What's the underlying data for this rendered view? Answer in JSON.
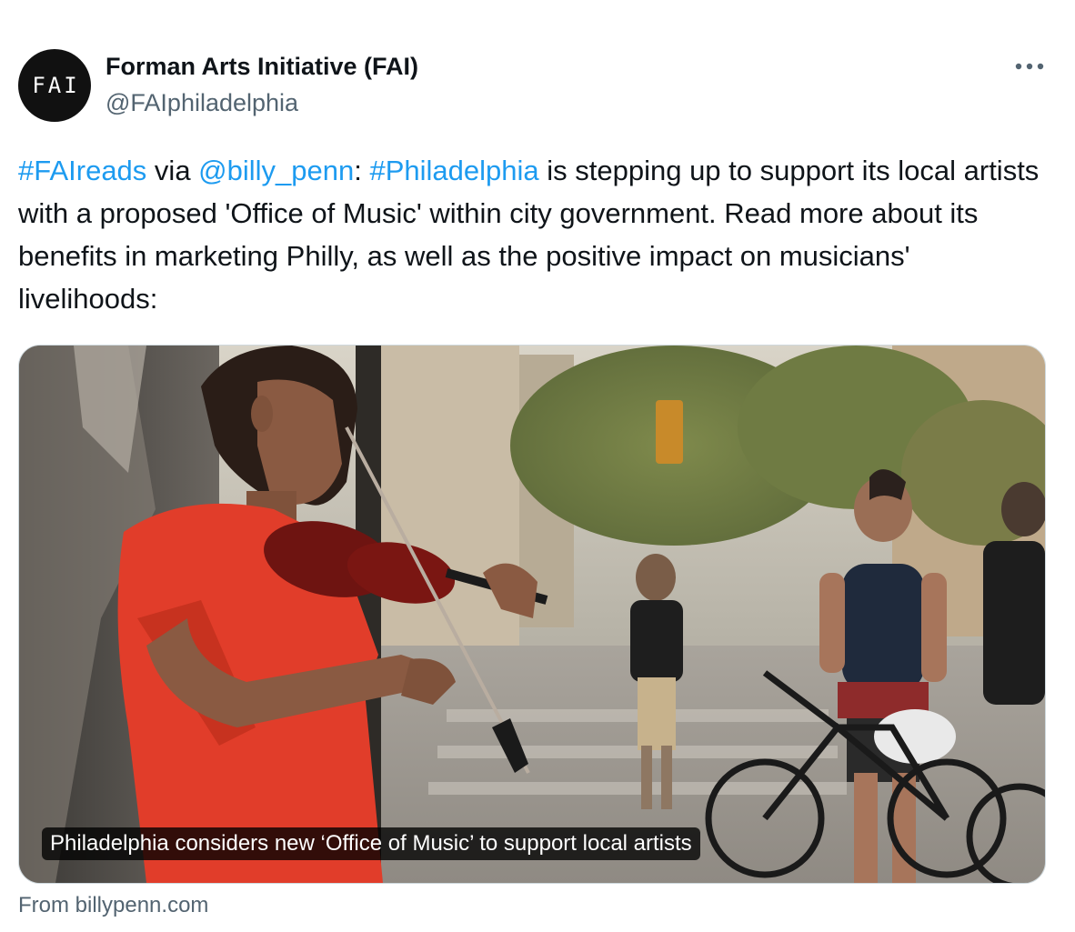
{
  "author": {
    "avatar_text": "FAI",
    "display_name": "Forman Arts Initiative (FAI)",
    "handle": "@FAIphiladelphia"
  },
  "more_icon": "more-horizontal-icon",
  "tweet": {
    "segments": [
      {
        "text": "#FAIreads",
        "link": true,
        "name": "hashtag-faireads"
      },
      {
        "text": " via ",
        "link": false,
        "name": "tweet-text-segment"
      },
      {
        "text": "@billy_penn",
        "link": true,
        "name": "mention-billy-penn"
      },
      {
        "text": ": ",
        "link": false,
        "name": "tweet-text-segment"
      },
      {
        "text": "#Philadelphia",
        "link": true,
        "name": "hashtag-philadelphia"
      },
      {
        "text": " is stepping up to support its local artists with a proposed 'Office of Music' within city government. Read more about its benefits in marketing Philly, as well as the positive impact on musicians' livelihoods:",
        "link": false,
        "name": "tweet-text-segment"
      }
    ]
  },
  "card": {
    "caption": "Philadelphia considers new ‘Office of Music’ to support local artists",
    "source": "From billypenn.com"
  },
  "colors": {
    "link": "#1d9bf0",
    "secondary_text": "#536471",
    "primary_text": "#0f1419",
    "card_border": "#cfd9de"
  }
}
